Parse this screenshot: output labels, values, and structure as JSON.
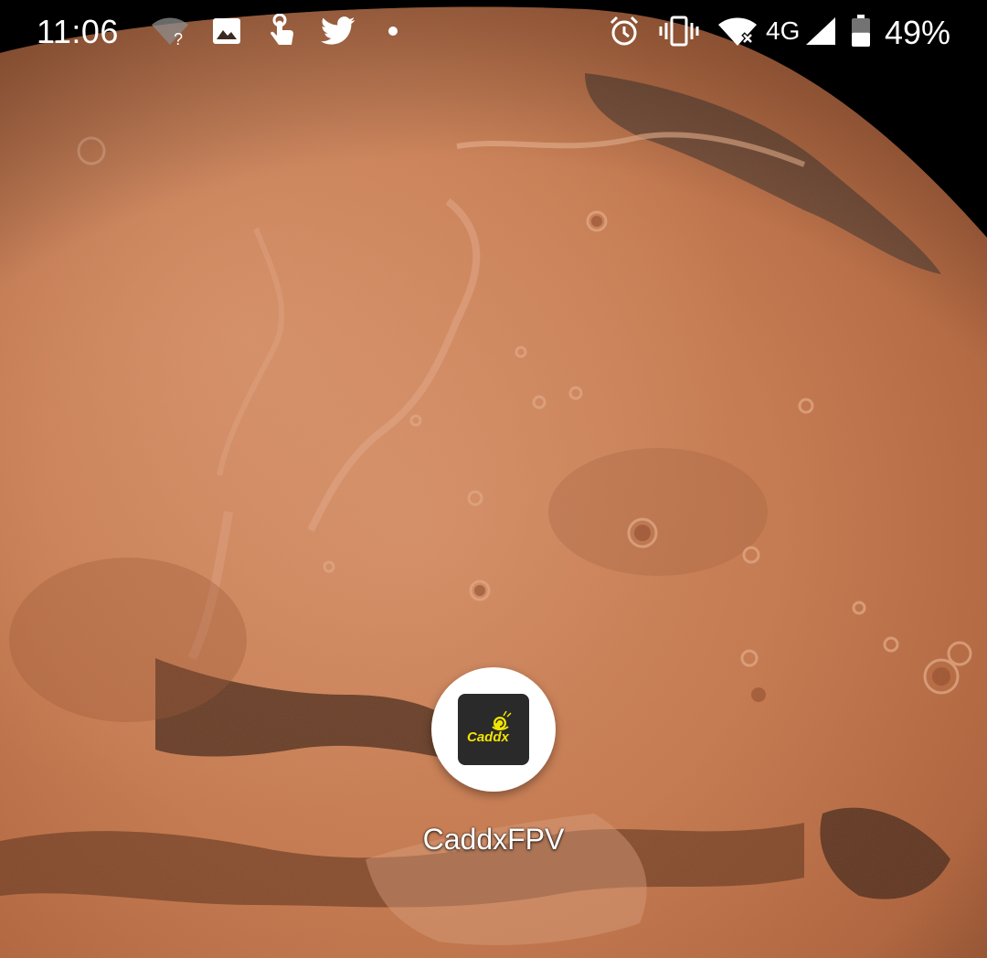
{
  "status_bar": {
    "time": "11:06",
    "network_type": "4G",
    "battery_percent": "49%",
    "battery_level": 0.49,
    "notification_icons": [
      "wifi-unknown-icon",
      "gallery-image-icon",
      "touch-gesture-icon",
      "twitter-bird-icon",
      "dot-icon"
    ],
    "system_icons": [
      "alarm-clock-icon",
      "vibrate-icon",
      "wifi-no-internet-icon",
      "cellular-signal-icon",
      "battery-icon"
    ],
    "wifi_unknown_glyph": "?"
  },
  "home_screen": {
    "apps": [
      {
        "label": "CaddxFPV",
        "icon_text": "Caddx",
        "icon_name": "caddx-app-icon"
      }
    ]
  },
  "colors": {
    "app_icon_bg": "#2a2a2a",
    "app_icon_accent": "#f2e400",
    "mars_light": "#d9875e",
    "mars_dark": "#8a4a2c"
  }
}
